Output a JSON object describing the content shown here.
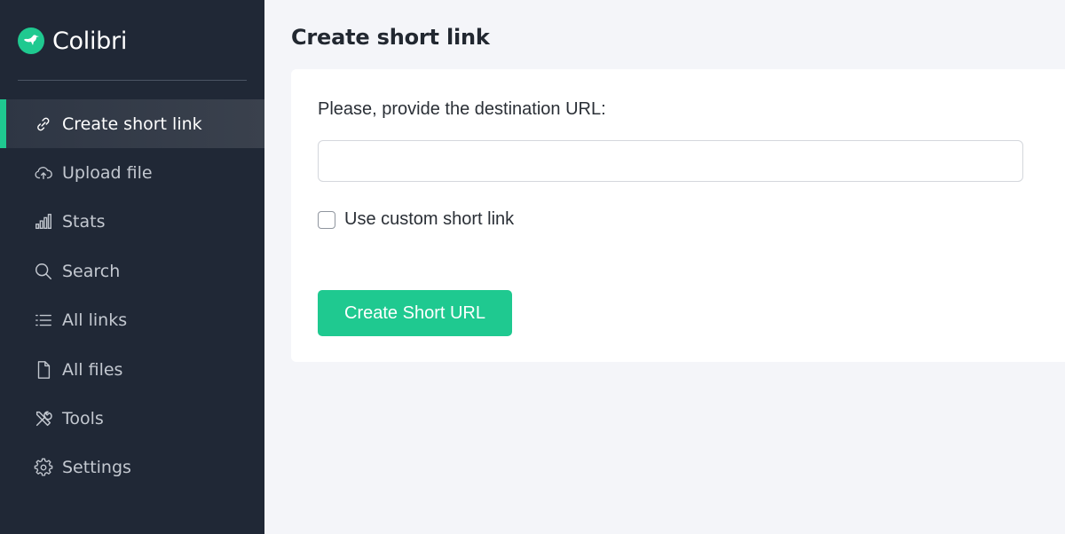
{
  "brand": {
    "name": "Colibri",
    "accent_color": "#1fc990",
    "logo_icon": "hummingbird-icon"
  },
  "sidebar": {
    "background_color": "#202836",
    "items": [
      {
        "label": "Create short link",
        "icon": "link-icon",
        "active": true
      },
      {
        "label": "Upload file",
        "icon": "cloud-upload-icon",
        "active": false
      },
      {
        "label": "Stats",
        "icon": "bar-chart-icon",
        "active": false
      },
      {
        "label": "Search",
        "icon": "search-icon",
        "active": false
      },
      {
        "label": "All links",
        "icon": "list-icon",
        "active": false
      },
      {
        "label": "All files",
        "icon": "file-icon",
        "active": false
      },
      {
        "label": "Tools",
        "icon": "tools-icon",
        "active": false
      },
      {
        "label": "Settings",
        "icon": "gear-icon",
        "active": false
      }
    ]
  },
  "main": {
    "title": "Create short link",
    "form": {
      "url_label": "Please, provide the destination URL:",
      "url_value": "",
      "custom_checkbox_label": "Use custom short link",
      "custom_checkbox_checked": false,
      "submit_label": "Create Short URL"
    }
  }
}
